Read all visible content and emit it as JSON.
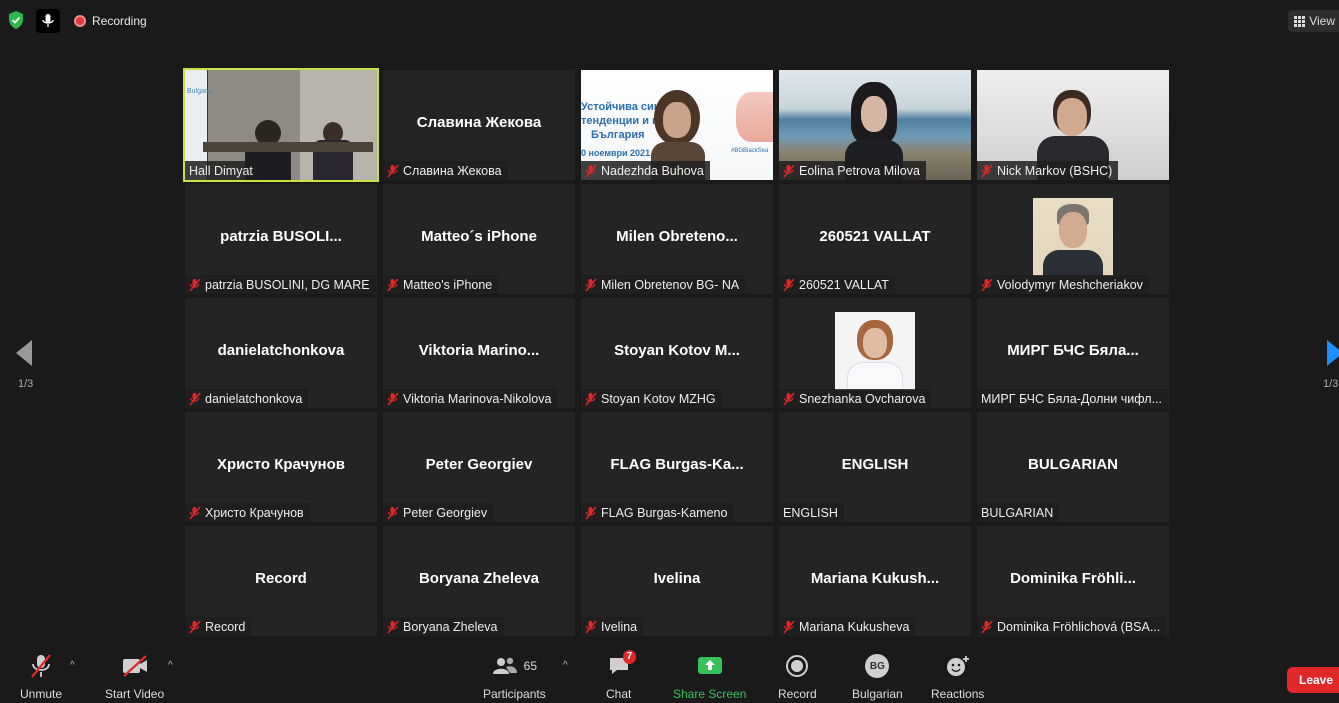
{
  "topbar": {
    "recording_label": "Recording",
    "view_label": "View"
  },
  "gallery": {
    "page_left": "1/3",
    "page_right": "1/3",
    "tiles": [
      {
        "big": "",
        "label": "Hall Dimyat",
        "muted": false
      },
      {
        "big": "Славина Жекова",
        "label": "Славина Жекова",
        "muted": true
      },
      {
        "big": "",
        "label": "Nadezhda Buhova",
        "muted": true
      },
      {
        "big": "",
        "label": "Eolina Petrova Milova",
        "muted": true
      },
      {
        "big": "",
        "label": "Nick Markov (BSHC)",
        "muted": true
      },
      {
        "big": "patrzia  BUSOLI...",
        "label": "patrzia BUSOLINI, DG MARE",
        "muted": true
      },
      {
        "big": "Matteo´s iPhone",
        "label": "Matteo's iPhone",
        "muted": true
      },
      {
        "big": "Milen  Obreteno...",
        "label": "Milen Obretenov BG- NA",
        "muted": true
      },
      {
        "big": "260521  VALLAT",
        "label": "260521  VALLAT",
        "muted": true
      },
      {
        "big": "",
        "label": "Volodymyr Meshcheriakov",
        "muted": true
      },
      {
        "big": "danielatchonkova",
        "label": "danielatchonkova",
        "muted": true
      },
      {
        "big": "Viktoria  Marino...",
        "label": "Viktoria Marinova-Nikolova",
        "muted": true
      },
      {
        "big": "Stoyan  Kotov  M...",
        "label": "Stoyan Kotov MZHG",
        "muted": true
      },
      {
        "big": "",
        "label": "Snezhanka Ovcharova",
        "muted": true
      },
      {
        "big": "МИРГ БЧС Бяла...",
        "label": "МИРГ БЧС Бяла-Долни чифл...",
        "muted": false
      },
      {
        "big": "Христо Крачунов",
        "label": "Христо Крачунов",
        "muted": true
      },
      {
        "big": "Peter Georgiev",
        "label": "Peter Georgiev",
        "muted": true
      },
      {
        "big": "FLAG  Burgas-Ka...",
        "label": "FLAG Burgas-Kameno",
        "muted": true
      },
      {
        "big": "ENGLISH",
        "label": "ENGLISH",
        "muted": false
      },
      {
        "big": "BULGARIAN",
        "label": "BULGARIAN",
        "muted": false
      },
      {
        "big": "Record",
        "label": "Record",
        "muted": true
      },
      {
        "big": "Boryana Zheleva",
        "label": "Boryana Zheleva",
        "muted": true
      },
      {
        "big": "Ivelina",
        "label": "Ivelina",
        "muted": true
      },
      {
        "big": "Mariana  Kukush...",
        "label": "Mariana Kukusheva",
        "muted": true
      },
      {
        "big": "Dominika  Fröhli...",
        "label": "Dominika Fröhlichová (BSA...",
        "muted": true
      }
    ],
    "slide": {
      "line1": "Устойчива сине...",
      "line2": "тенденции и п...",
      "line3": "България",
      "date": "0 ноември 2021",
      "hashtag": "#BGBlackSea"
    },
    "room_slide_text": "Bulgaria"
  },
  "toolbar": {
    "unmute": "Unmute",
    "start_video": "Start Video",
    "participants": "Participants",
    "participants_count": "65",
    "chat": "Chat",
    "chat_badge": "7",
    "share_screen": "Share Screen",
    "record": "Record",
    "language": "Bulgarian",
    "language_code": "BG",
    "reactions": "Reactions",
    "leave": "Leave"
  },
  "colors": {
    "background": "#1a1a1a",
    "tile": "#242424",
    "active_speaker": "#c8e043",
    "share_green": "#37c15a",
    "leave_red": "#e02828",
    "mute_red": "#e02828",
    "nav_left": "#9a9a9a",
    "nav_right": "#1e8fff"
  }
}
